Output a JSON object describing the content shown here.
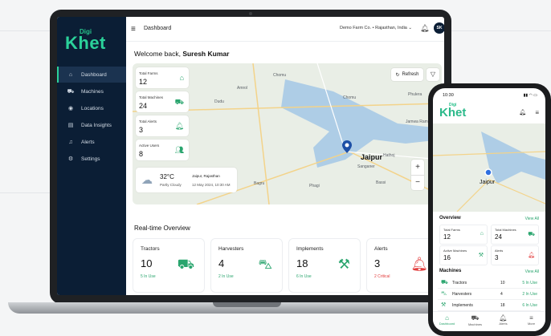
{
  "brand": {
    "digi": "Digi",
    "khet": "Khet"
  },
  "sidebar": {
    "items": [
      {
        "label": "Dashboard",
        "icon": "home-icon"
      },
      {
        "label": "Machines",
        "icon": "tractor-icon"
      },
      {
        "label": "Locations",
        "icon": "location-pin-icon"
      },
      {
        "label": "Data Insights",
        "icon": "chart-icon"
      },
      {
        "label": "Alerts",
        "icon": "bell-icon"
      },
      {
        "label": "Settings",
        "icon": "gear-icon"
      }
    ]
  },
  "topbar": {
    "title": "Dashboard",
    "farm": "Demo Farm Co. • Rajasthan, India ⌄",
    "avatar": "SK"
  },
  "welcome": {
    "prefix": "Welcome back, ",
    "name": "Suresh Kumar"
  },
  "map": {
    "refresh": "Refresh",
    "pin": "Jaipur",
    "labels": [
      "Chomu",
      "Amrol",
      "Dudu",
      "Chomu",
      "Jamwa Ramgarh",
      "Phulera",
      "Sanganer",
      "Bagru",
      "Bassi",
      "Phagi",
      "Hathoj"
    ],
    "stats": [
      {
        "label": "Total Farms",
        "value": "12"
      },
      {
        "label": "Total Machines",
        "value": "24"
      },
      {
        "label": "Total Alerts",
        "value": "3"
      },
      {
        "label": "Active Users",
        "value": "8"
      }
    ],
    "weather": {
      "temp": "32°C",
      "cond": "Partly Cloudy",
      "place": "Jaipur, Rajasthan",
      "time": "12 May 2024, 10:30 AM"
    }
  },
  "overview": {
    "title": "Real-time Overview",
    "cards": [
      {
        "label": "Tractors",
        "value": "10",
        "sub": "5 In Use",
        "icon": "tractor-icon"
      },
      {
        "label": "Harvesters",
        "value": "4",
        "sub": "2 In Use",
        "icon": "harvester-icon"
      },
      {
        "label": "Implements",
        "value": "18",
        "sub": "6 In Use",
        "icon": "implement-icon"
      },
      {
        "label": "Alerts",
        "value": "3",
        "sub": "2 Critical",
        "icon": "alert-bell-icon"
      }
    ]
  },
  "phone": {
    "time": "10:30",
    "map_pin": "Jaipur",
    "overview_title": "Overview",
    "view_all": "View All",
    "stats": [
      {
        "label": "Total Farms",
        "value": "12"
      },
      {
        "label": "Total Machines",
        "value": "24"
      },
      {
        "label": "Active Machines",
        "value": "16"
      },
      {
        "label": "Alerts",
        "value": "3"
      }
    ],
    "machines_title": "Machines",
    "machines": [
      {
        "name": "Tractors",
        "value": "10",
        "use": "5 In Use"
      },
      {
        "name": "Harvesters",
        "value": "4",
        "use": "2 In Use"
      },
      {
        "name": "Implements",
        "value": "18",
        "use": "6 In Use"
      }
    ],
    "tabs": [
      "Dashboard",
      "Machines",
      "Alerts",
      "More"
    ]
  }
}
